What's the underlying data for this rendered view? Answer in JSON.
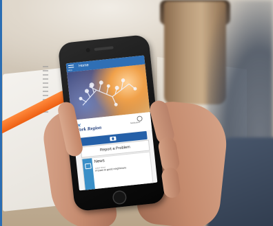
{
  "app": {
    "header_title": "Home",
    "menu_label": "Menu",
    "brand_name": "York Region",
    "notifications_label": "Notifications",
    "report_label": "Report a Problem",
    "news": {
      "title": "News",
      "meta": "Latest News",
      "headline": "A toast to good neighbours"
    }
  },
  "colors": {
    "app_bar": "#2f6fb5",
    "camera_bar": "#2560a8",
    "news_icon": "#3a8fc7",
    "pencil": "#ee5f12"
  },
  "icons": [
    "menu-icon",
    "notifications-icon",
    "camera-icon",
    "news-icon"
  ]
}
